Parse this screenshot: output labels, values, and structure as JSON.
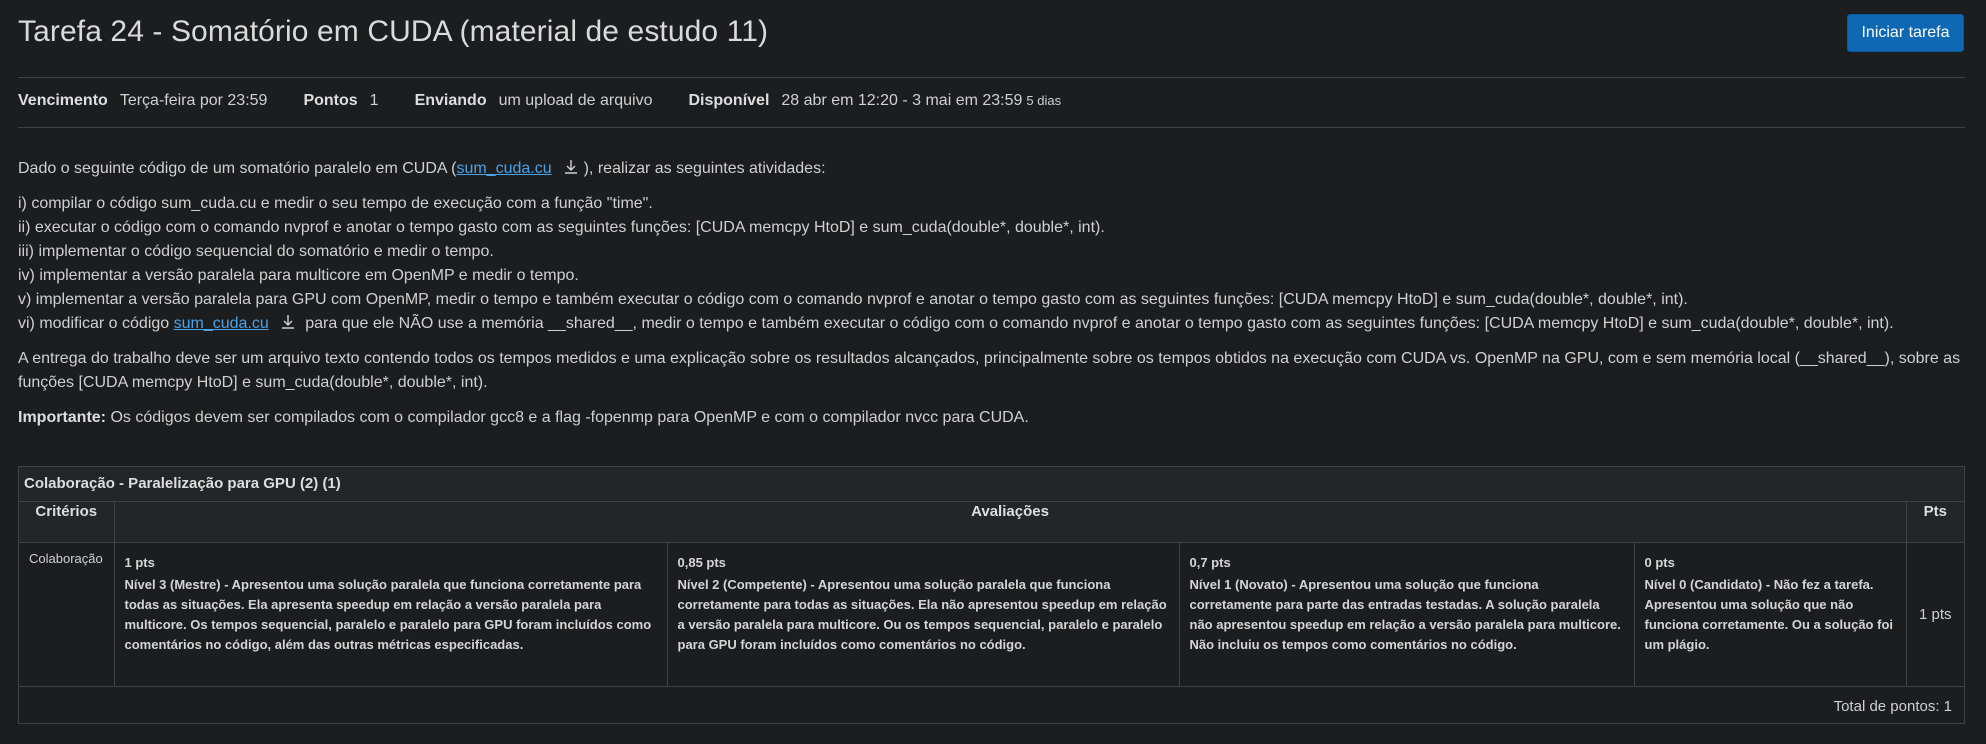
{
  "header": {
    "title": "Tarefa 24 - Somatório em CUDA (material de estudo 11)",
    "start_button": "Iniciar tarefa"
  },
  "meta": {
    "due_label": "Vencimento",
    "due_value": "Terça-feira por 23:59",
    "points_label": "Pontos",
    "points_value": "1",
    "submitting_label": "Enviando",
    "submitting_value": "um upload de arquivo",
    "available_label": "Disponível",
    "available_value": "28 abr em 12:20 - 3 mai em 23:59",
    "available_days": "5 dias"
  },
  "description": {
    "intro_before": "Dado o seguinte código de um somatório paralelo em CUDA (",
    "intro_link": "sum_cuda.cu",
    "intro_after": "), realizar as seguintes atividades:",
    "items": [
      "i) compilar o código sum_cuda.cu e medir o seu tempo de execução com a função \"time\".",
      "ii) executar o código com o comando nvprof e anotar o tempo gasto com as seguintes funções: [CUDA memcpy HtoD] e sum_cuda(double*, double*, int).",
      "iii) implementar o código sequencial do somatório e medir o tempo.",
      "iv) implementar a versão paralela para multicore em OpenMP e medir o tempo.",
      "v) implementar a versão paralela para GPU com OpenMP, medir o tempo e também executar o código com o comando nvprof e anotar o tempo gasto com as seguintes funções: [CUDA memcpy HtoD] e sum_cuda(double*, double*, int)."
    ],
    "item6_before": "vi) modificar o código ",
    "item6_link": "sum_cuda.cu",
    "item6_after": " para que ele NÃO use a memória __shared__, medir o tempo e também executar o código com o comando nvprof e anotar o tempo gasto com as seguintes funções: [CUDA memcpy HtoD] e sum_cuda(double*, double*, int).",
    "delivery": "A entrega do trabalho deve ser um arquivo texto contendo todos os tempos medidos e uma explicação sobre os resultados alcançados, principalmente sobre os tempos obtidos na execução com CUDA vs. OpenMP na GPU, com e sem memória local (__shared__), sobre as funções [CUDA memcpy HtoD] e sum_cuda(double*, double*, int).",
    "important_label": "Importante:",
    "important_text": " Os códigos devem ser compilados com o compilador gcc8 e a flag -fopenmp para OpenMP e com o compilador nvcc para CUDA."
  },
  "rubric": {
    "title": "Colaboração - Paralelização para GPU (2) (1)",
    "headers": {
      "criteria": "Critérios",
      "ratings": "Avaliações",
      "pts": "Pts"
    },
    "criterion": "Colaboração",
    "ratings": [
      {
        "points": "1 pts",
        "text": "Nível 3 (Mestre) - Apresentou uma solução paralela que funciona corretamente para todas as situações. Ela apresenta speedup em relação a versão paralela para multicore. Os tempos sequencial, paralelo e paralelo para GPU foram incluídos como comentários no código, além das outras métricas especificadas."
      },
      {
        "points": "0,85 pts",
        "text": "Nível 2 (Competente) - Apresentou uma solução paralela que funciona corretamente para todas as situações. Ela não apresentou speedup em relação a versão paralela para multicore. Ou os tempos sequencial, paralelo e paralelo para GPU foram incluídos como comentários no código."
      },
      {
        "points": "0,7 pts",
        "text": "Nível 1 (Novato) - Apresentou uma solução que funciona corretamente para parte das entradas testadas. A solução paralela não apresentou speedup em relação a versão paralela para multicore. Não incluiu os tempos como comentários no código."
      },
      {
        "points": "0 pts",
        "text": "Nível 0 (Candidato) - Não fez a tarefa. Apresentou uma solução que não funciona corretamente. Ou a solução foi um plágio."
      }
    ],
    "criterion_points": "1 pts",
    "total": "Total de pontos: 1"
  }
}
